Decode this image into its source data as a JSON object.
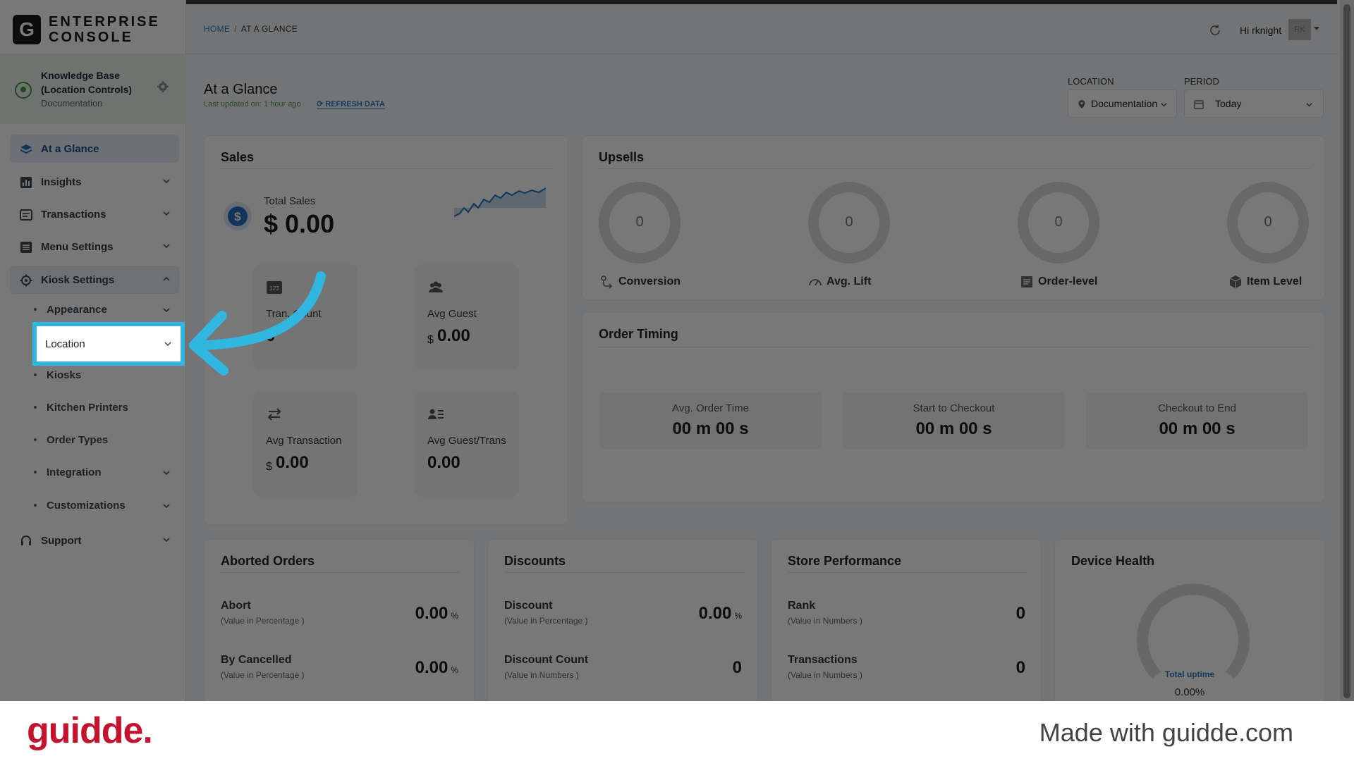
{
  "app": {
    "logo_letter": "G",
    "logo_line1": "ENTERPRISE",
    "logo_line2": "CONSOLE"
  },
  "knowledge_base": {
    "title": "Knowledge Base (Location Controls)",
    "subtitle": "Documentation"
  },
  "sidebar": {
    "items": [
      {
        "label": "At a Glance",
        "icon": "layers-icon"
      },
      {
        "label": "Insights",
        "icon": "chart-icon"
      },
      {
        "label": "Transactions",
        "icon": "receipt-icon"
      },
      {
        "label": "Menu Settings",
        "icon": "menu-icon"
      },
      {
        "label": "Kiosk Settings",
        "icon": "gear-icon"
      },
      {
        "label": "Support",
        "icon": "headset-icon"
      }
    ],
    "sub_items": [
      {
        "label": "Appearance"
      },
      {
        "label": "Location"
      },
      {
        "label": "Kiosks"
      },
      {
        "label": "Kitchen Printers"
      },
      {
        "label": "Order Types"
      },
      {
        "label": "Integration"
      },
      {
        "label": "Customizations"
      }
    ]
  },
  "breadcrumb": {
    "home": "HOME",
    "separator": "/",
    "current": "AT A GLANCE"
  },
  "header": {
    "greeting": "Hi rknight",
    "avatar_initials": "RK"
  },
  "page": {
    "title": "At a Glance",
    "updated": "Last updated on: 1 hour ago",
    "refresh": "REFRESH DATA"
  },
  "filters": {
    "location_label": "LOCATION",
    "location_value": "Documentation",
    "period_label": "PERIOD",
    "period_value": "Today"
  },
  "sales": {
    "title": "Sales",
    "total_label": "Total Sales",
    "total_value": "$ 0.00",
    "metrics": [
      {
        "label": "Tran. Count",
        "value": "0",
        "currency": ""
      },
      {
        "label": "Avg Guest",
        "value": "0.00",
        "currency": "$"
      },
      {
        "label": "Avg Transaction",
        "value": "0.00",
        "currency": "$"
      },
      {
        "label": "Avg Guest/Trans",
        "value": "0.00",
        "currency": ""
      }
    ]
  },
  "upsells": {
    "title": "Upsells",
    "items": [
      {
        "label": "Conversion",
        "value": "0"
      },
      {
        "label": "Avg. Lift",
        "value": "0"
      },
      {
        "label": "Order-level",
        "value": "0"
      },
      {
        "label": "Item Level",
        "value": "0"
      }
    ]
  },
  "order_timing": {
    "title": "Order Timing",
    "items": [
      {
        "label": "Avg. Order Time",
        "value": "00 m 00 s"
      },
      {
        "label": "Start to Checkout",
        "value": "00 m 00 s"
      },
      {
        "label": "Checkout to End",
        "value": "00 m 00 s"
      }
    ]
  },
  "aborted": {
    "title": "Aborted Orders",
    "rows": [
      {
        "label": "Abort",
        "sub": "(Value in Percentage )",
        "value": "0.00",
        "unit": "%"
      },
      {
        "label": "By Cancelled",
        "sub": "(Value in Percentage )",
        "value": "0.00",
        "unit": "%"
      }
    ]
  },
  "discounts": {
    "title": "Discounts",
    "rows": [
      {
        "label": "Discount",
        "sub": "(Value in Percentage )",
        "value": "0.00",
        "unit": "%"
      },
      {
        "label": "Discount Count",
        "sub": "(Value in Numbers )",
        "value": "0",
        "unit": ""
      }
    ]
  },
  "store": {
    "title": "Store Performance",
    "rows": [
      {
        "label": "Rank",
        "sub": "(Value in Numbers )",
        "value": "0",
        "unit": ""
      },
      {
        "label": "Transactions",
        "sub": "(Value in Numbers )",
        "value": "0",
        "unit": ""
      }
    ]
  },
  "device": {
    "title": "Device Health",
    "uptime_label": "Total uptime",
    "uptime_value": "0.00%",
    "uptime_fraction": 0
  },
  "footer": {
    "brand": "guidde.",
    "made_with": "Made with guidde.com"
  },
  "colors": {
    "accent": "#2a7bc4",
    "highlight": "#31b6e0",
    "brand_red": "#c4122f"
  }
}
